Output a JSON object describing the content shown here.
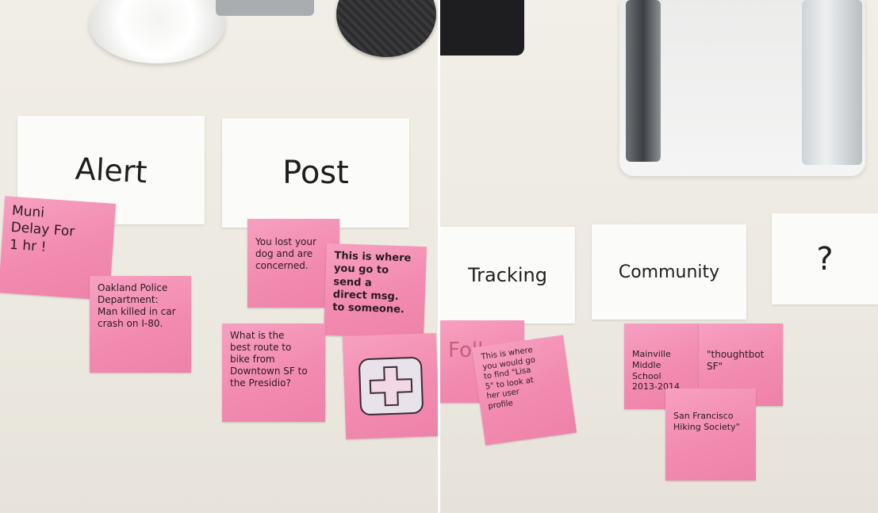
{
  "left_board": {
    "cards": [
      {
        "label": "Alert"
      },
      {
        "label": "Post"
      }
    ],
    "notes": [
      {
        "text": "Muni\nDelay For\n1 hr !"
      },
      {
        "text": "Oakland Police\nDepartment:\nMan killed in car\ncrash on I-80."
      },
      {
        "text": "You lost your\ndog and are\nconcerned."
      },
      {
        "text": "This is where\nyou go to\nsend a\ndirect msg.\nto someone."
      },
      {
        "text": "What is the\nbest route to\nbike from\nDowntown SF to\nthe Presidio?"
      },
      {
        "icon": "plus-icon"
      }
    ]
  },
  "right_board": {
    "cards": [
      {
        "label": "Tracking"
      },
      {
        "label": "Community"
      },
      {
        "label": "?"
      }
    ],
    "notes": [
      {
        "text": "Follow"
      },
      {
        "text": "This is where\nyou would go\nto find \"Lisa\n5\" to look at\nher user\nprofile"
      },
      {
        "text": "Mainville\nMiddle School\n2013-2014"
      },
      {
        "text": "\"thoughtbot\nSF\""
      },
      {
        "text": "San Francisco\nHiking Society\""
      }
    ]
  },
  "colors": {
    "sticky_note": "#f48fb1",
    "index_card": "#fbfbf9",
    "desk": "#efece3"
  }
}
